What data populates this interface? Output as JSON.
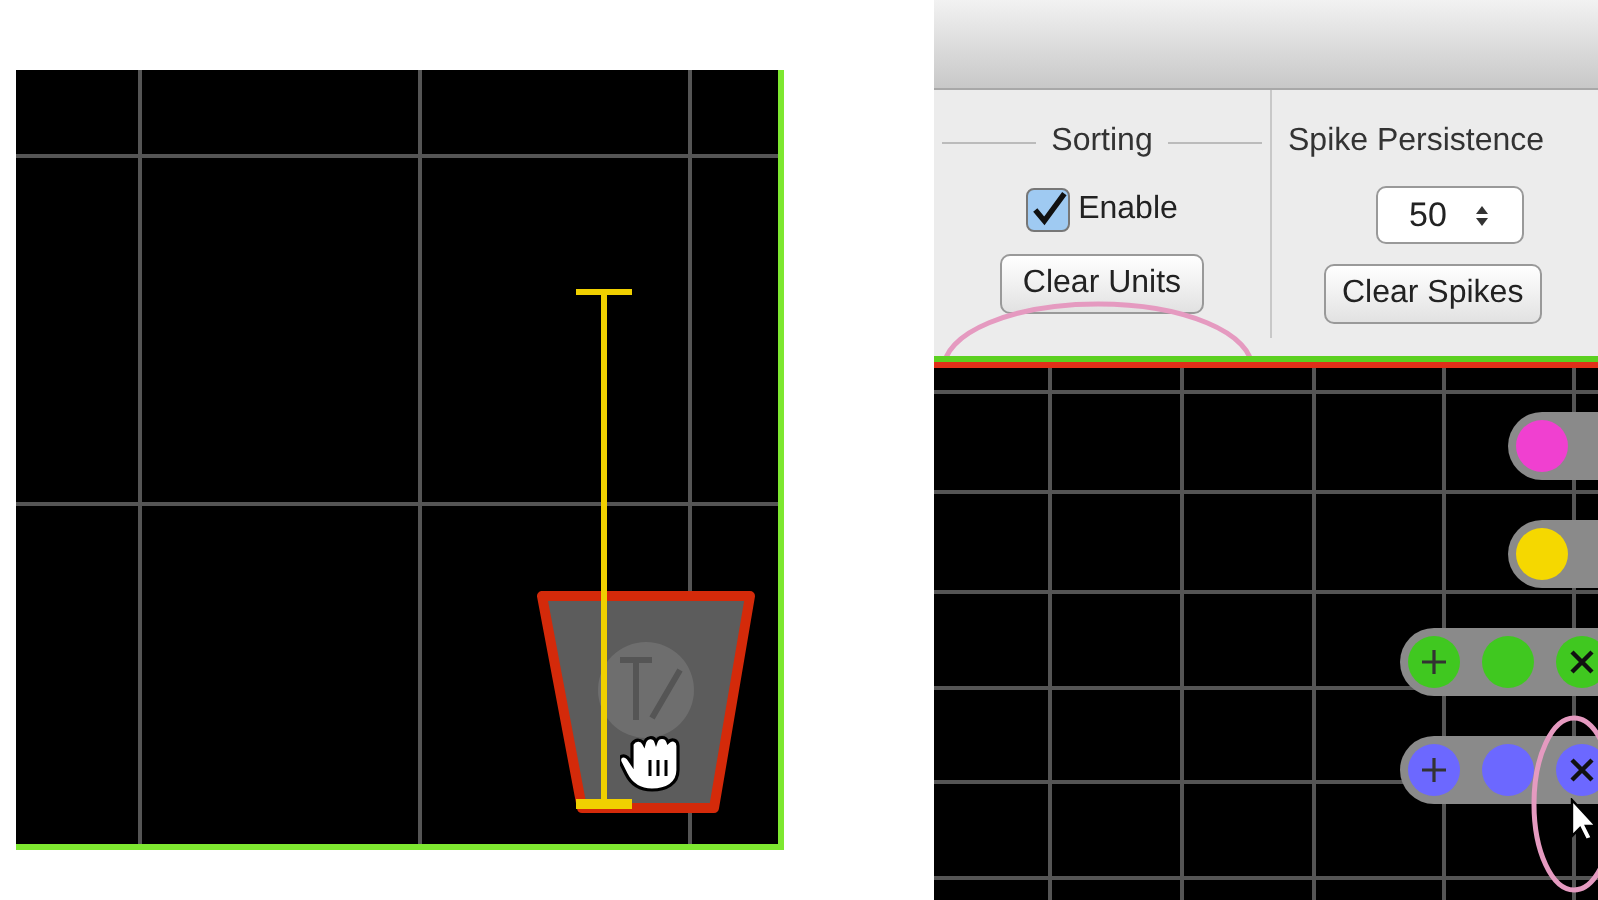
{
  "sorting": {
    "title": "Sorting",
    "enable": {
      "label": "Enable",
      "checked": true
    },
    "button": "Clear Units"
  },
  "spike_persistence": {
    "title": "Spike Persistence",
    "value": "50",
    "button": "Clear Spikes"
  },
  "units": [
    {
      "kind": "collapsed",
      "color": "#f040d0"
    },
    {
      "kind": "collapsed",
      "color": "#f5d800"
    },
    {
      "kind": "expanded",
      "color": "#40c820"
    },
    {
      "kind": "expanded",
      "color": "#6c68ff"
    }
  ]
}
